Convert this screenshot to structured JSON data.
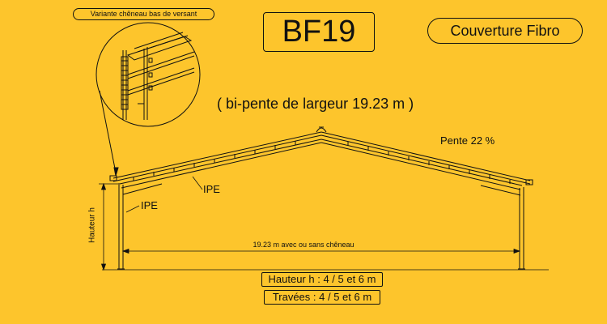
{
  "title": "BF19",
  "cover_label": "Couverture Fibro",
  "variant_label": "Variante chêneau bas de versant",
  "subtitle": "( bi-pente de largeur 19.23 m )",
  "slope_label": "Pente 22 %",
  "beam_label_rafter": "IPE",
  "beam_label_column": "IPE",
  "height_axis_label": "Hauteur h",
  "width_label": "19.23 m avec ou sans chêneau",
  "height_options": "Hauteur h : 4 / 5 et 6  m",
  "bay_options": "Travées : 4 / 5  et  6  m",
  "colors": {
    "background": "#FDC52C",
    "line": "#111111"
  }
}
